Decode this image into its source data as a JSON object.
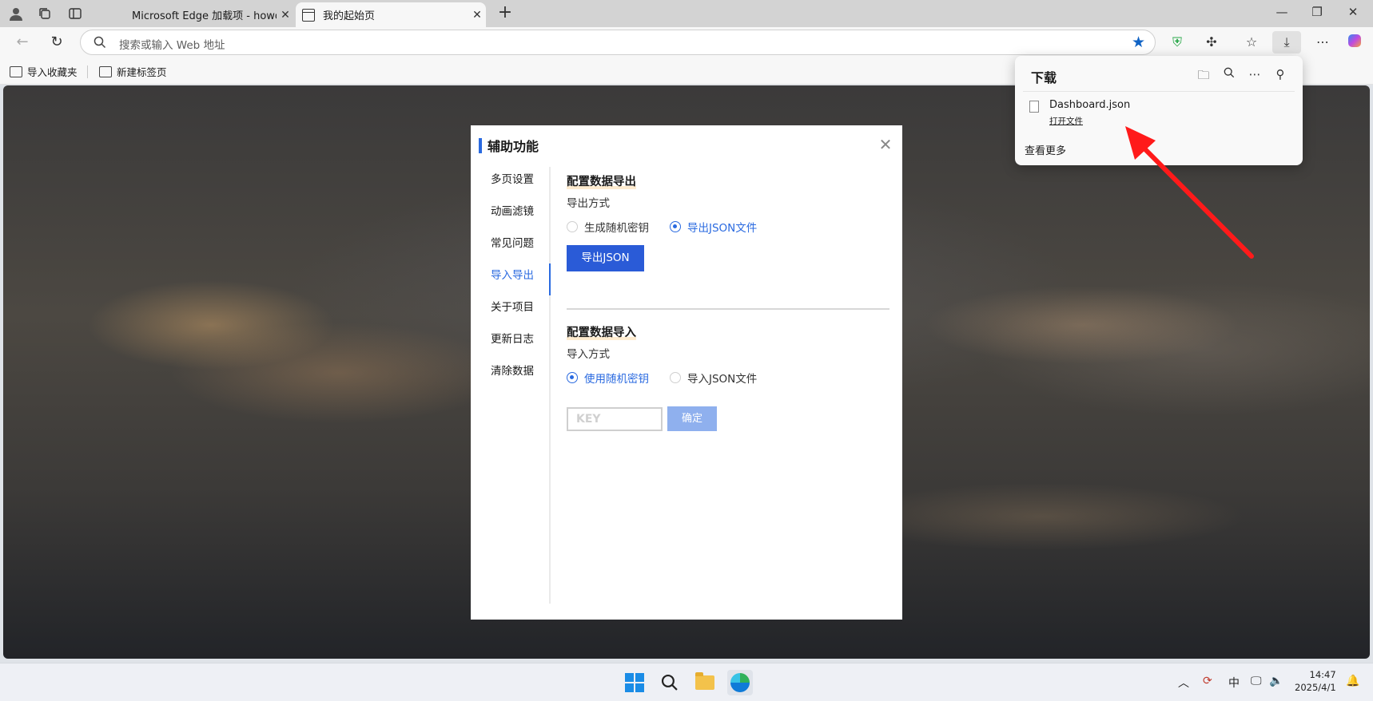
{
  "browser": {
    "tabs": [
      {
        "title": "Microsoft Edge 加载项 - howdz起"
      },
      {
        "title": "我的起始页"
      }
    ],
    "address_placeholder": "搜索或输入 Web 地址",
    "favorites": [
      {
        "label": "导入收藏夹"
      },
      {
        "label": "新建标签页"
      }
    ]
  },
  "modal": {
    "title": "辅助功能",
    "sidebar": [
      {
        "label": "多页设置"
      },
      {
        "label": "动画滤镜"
      },
      {
        "label": "常见问题"
      },
      {
        "label": "导入导出"
      },
      {
        "label": "关于项目"
      },
      {
        "label": "更新日志"
      },
      {
        "label": "清除数据"
      }
    ],
    "active_sidebar_item": "导入导出",
    "export": {
      "title": "配置数据导出",
      "method_label": "导出方式",
      "options": [
        {
          "label": "生成随机密钥",
          "selected": false
        },
        {
          "label": "导出JSON文件",
          "selected": true
        }
      ],
      "button": "导出JSON"
    },
    "import": {
      "title": "配置数据导入",
      "method_label": "导入方式",
      "options": [
        {
          "label": "使用随机密钥",
          "selected": true
        },
        {
          "label": "导入JSON文件",
          "selected": false
        }
      ],
      "key_placeholder": "KEY",
      "confirm_button": "确定"
    }
  },
  "downloads": {
    "title": "下载",
    "file_name": "Dashboard.json",
    "open_file": "打开文件",
    "see_more": "查看更多"
  },
  "taskbar": {
    "ime": "中",
    "time": "14:47",
    "date": "2025/4/1"
  },
  "colors": {
    "accent": "#2a6ae0",
    "export_button": "#2a5bd7",
    "confirm_button_disabled": "#8fb0ee",
    "annotation_arrow": "#ff1a1a"
  }
}
